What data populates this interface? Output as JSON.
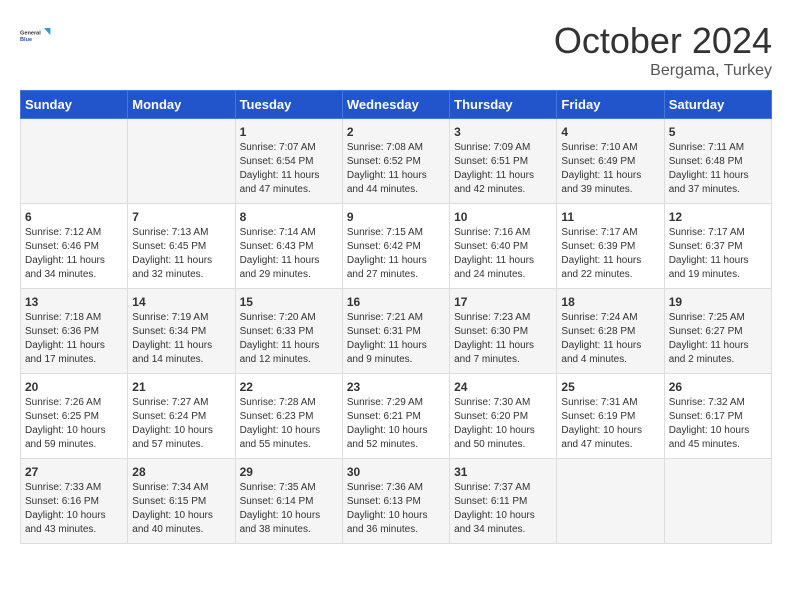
{
  "header": {
    "logo_line1": "General",
    "logo_line2": "Blue",
    "month": "October 2024",
    "location": "Bergama, Turkey"
  },
  "weekdays": [
    "Sunday",
    "Monday",
    "Tuesday",
    "Wednesday",
    "Thursday",
    "Friday",
    "Saturday"
  ],
  "weeks": [
    [
      {
        "day": "",
        "info": ""
      },
      {
        "day": "",
        "info": ""
      },
      {
        "day": "1",
        "info": "Sunrise: 7:07 AM\nSunset: 6:54 PM\nDaylight: 11 hours and 47 minutes."
      },
      {
        "day": "2",
        "info": "Sunrise: 7:08 AM\nSunset: 6:52 PM\nDaylight: 11 hours and 44 minutes."
      },
      {
        "day": "3",
        "info": "Sunrise: 7:09 AM\nSunset: 6:51 PM\nDaylight: 11 hours and 42 minutes."
      },
      {
        "day": "4",
        "info": "Sunrise: 7:10 AM\nSunset: 6:49 PM\nDaylight: 11 hours and 39 minutes."
      },
      {
        "day": "5",
        "info": "Sunrise: 7:11 AM\nSunset: 6:48 PM\nDaylight: 11 hours and 37 minutes."
      }
    ],
    [
      {
        "day": "6",
        "info": "Sunrise: 7:12 AM\nSunset: 6:46 PM\nDaylight: 11 hours and 34 minutes."
      },
      {
        "day": "7",
        "info": "Sunrise: 7:13 AM\nSunset: 6:45 PM\nDaylight: 11 hours and 32 minutes."
      },
      {
        "day": "8",
        "info": "Sunrise: 7:14 AM\nSunset: 6:43 PM\nDaylight: 11 hours and 29 minutes."
      },
      {
        "day": "9",
        "info": "Sunrise: 7:15 AM\nSunset: 6:42 PM\nDaylight: 11 hours and 27 minutes."
      },
      {
        "day": "10",
        "info": "Sunrise: 7:16 AM\nSunset: 6:40 PM\nDaylight: 11 hours and 24 minutes."
      },
      {
        "day": "11",
        "info": "Sunrise: 7:17 AM\nSunset: 6:39 PM\nDaylight: 11 hours and 22 minutes."
      },
      {
        "day": "12",
        "info": "Sunrise: 7:17 AM\nSunset: 6:37 PM\nDaylight: 11 hours and 19 minutes."
      }
    ],
    [
      {
        "day": "13",
        "info": "Sunrise: 7:18 AM\nSunset: 6:36 PM\nDaylight: 11 hours and 17 minutes."
      },
      {
        "day": "14",
        "info": "Sunrise: 7:19 AM\nSunset: 6:34 PM\nDaylight: 11 hours and 14 minutes."
      },
      {
        "day": "15",
        "info": "Sunrise: 7:20 AM\nSunset: 6:33 PM\nDaylight: 11 hours and 12 minutes."
      },
      {
        "day": "16",
        "info": "Sunrise: 7:21 AM\nSunset: 6:31 PM\nDaylight: 11 hours and 9 minutes."
      },
      {
        "day": "17",
        "info": "Sunrise: 7:23 AM\nSunset: 6:30 PM\nDaylight: 11 hours and 7 minutes."
      },
      {
        "day": "18",
        "info": "Sunrise: 7:24 AM\nSunset: 6:28 PM\nDaylight: 11 hours and 4 minutes."
      },
      {
        "day": "19",
        "info": "Sunrise: 7:25 AM\nSunset: 6:27 PM\nDaylight: 11 hours and 2 minutes."
      }
    ],
    [
      {
        "day": "20",
        "info": "Sunrise: 7:26 AM\nSunset: 6:25 PM\nDaylight: 10 hours and 59 minutes."
      },
      {
        "day": "21",
        "info": "Sunrise: 7:27 AM\nSunset: 6:24 PM\nDaylight: 10 hours and 57 minutes."
      },
      {
        "day": "22",
        "info": "Sunrise: 7:28 AM\nSunset: 6:23 PM\nDaylight: 10 hours and 55 minutes."
      },
      {
        "day": "23",
        "info": "Sunrise: 7:29 AM\nSunset: 6:21 PM\nDaylight: 10 hours and 52 minutes."
      },
      {
        "day": "24",
        "info": "Sunrise: 7:30 AM\nSunset: 6:20 PM\nDaylight: 10 hours and 50 minutes."
      },
      {
        "day": "25",
        "info": "Sunrise: 7:31 AM\nSunset: 6:19 PM\nDaylight: 10 hours and 47 minutes."
      },
      {
        "day": "26",
        "info": "Sunrise: 7:32 AM\nSunset: 6:17 PM\nDaylight: 10 hours and 45 minutes."
      }
    ],
    [
      {
        "day": "27",
        "info": "Sunrise: 7:33 AM\nSunset: 6:16 PM\nDaylight: 10 hours and 43 minutes."
      },
      {
        "day": "28",
        "info": "Sunrise: 7:34 AM\nSunset: 6:15 PM\nDaylight: 10 hours and 40 minutes."
      },
      {
        "day": "29",
        "info": "Sunrise: 7:35 AM\nSunset: 6:14 PM\nDaylight: 10 hours and 38 minutes."
      },
      {
        "day": "30",
        "info": "Sunrise: 7:36 AM\nSunset: 6:13 PM\nDaylight: 10 hours and 36 minutes."
      },
      {
        "day": "31",
        "info": "Sunrise: 7:37 AM\nSunset: 6:11 PM\nDaylight: 10 hours and 34 minutes."
      },
      {
        "day": "",
        "info": ""
      },
      {
        "day": "",
        "info": ""
      }
    ]
  ]
}
